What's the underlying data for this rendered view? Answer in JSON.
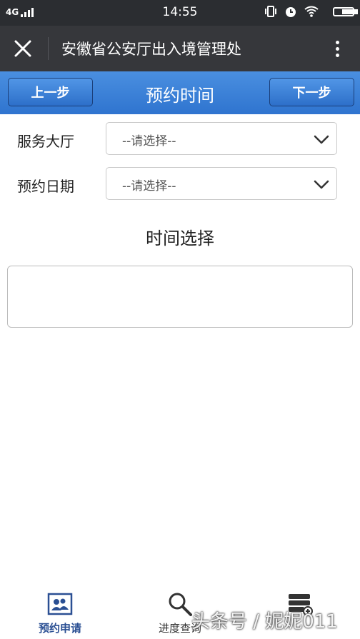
{
  "status_bar": {
    "network": "4G",
    "time": "14:55",
    "battery_level": 0.9
  },
  "header": {
    "title": "安徽省公安厅出入境管理处",
    "close_icon": "close-icon",
    "more_icon": "more-vertical-icon"
  },
  "nav": {
    "prev_label": "上一步",
    "title": "预约时间",
    "next_label": "下一步"
  },
  "form": {
    "hall": {
      "label": "服务大厅",
      "value": "--请选择--"
    },
    "date": {
      "label": "预约日期",
      "value": "--请选择--"
    }
  },
  "time_section": {
    "title": "时间选择"
  },
  "tabbar": {
    "tabs": [
      {
        "label": "预约申请",
        "icon": "people-card-icon",
        "active": true
      },
      {
        "label": "进度查询",
        "icon": "search-icon",
        "active": false
      },
      {
        "label": "",
        "icon": "server-add-icon",
        "active": false
      }
    ]
  },
  "watermark": "头条号 / 妮妮011",
  "colors": {
    "header_bg": "#36373b",
    "nav_bg": "#2f74cf",
    "active_tab": "#2a4f93"
  }
}
